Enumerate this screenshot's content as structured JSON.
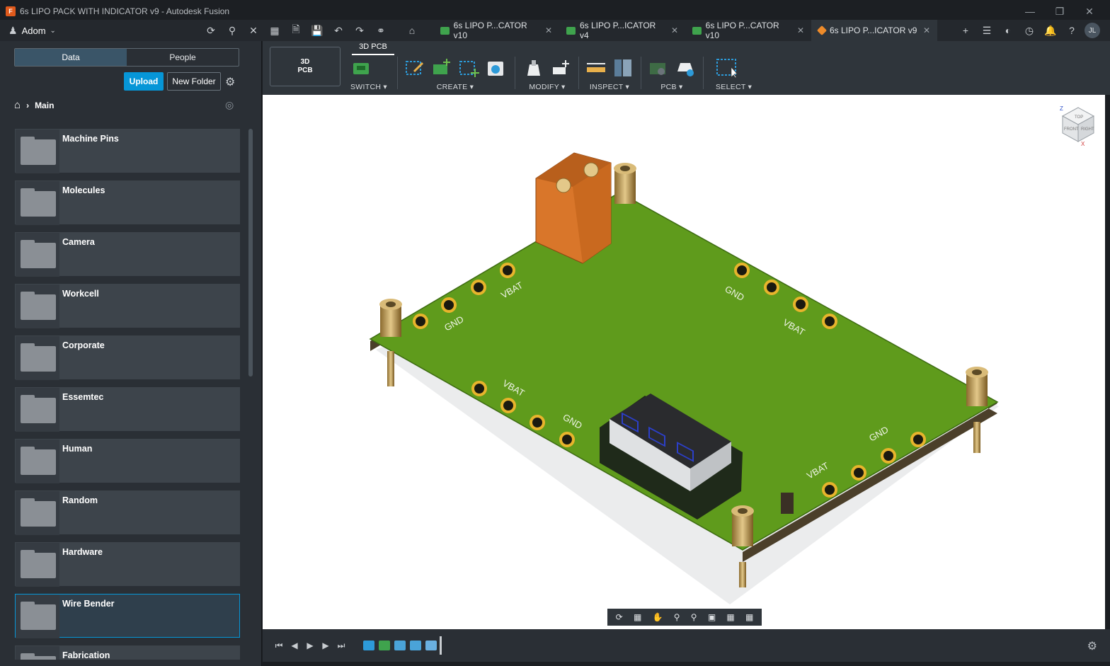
{
  "window": {
    "title": "6s LIPO PACK WITH INDICATOR v9 - Autodesk Fusion",
    "app_logo_letter": "F"
  },
  "topbar": {
    "team": "Adom",
    "avatar": "JL"
  },
  "tabs": [
    {
      "label": "6s LIPO P...CATOR v10",
      "icon": "pcb-icon"
    },
    {
      "label": "6s LIPO P...ICATOR v4",
      "icon": "schematic-icon"
    },
    {
      "label": "6s LIPO P...CATOR v10",
      "icon": "board-icon"
    },
    {
      "label": "6s LIPO P...ICATOR v9",
      "icon": "3d-model-icon"
    }
  ],
  "datapanel": {
    "segments": {
      "data": "Data",
      "people": "People"
    },
    "upload": "Upload",
    "new_folder": "New Folder",
    "breadcrumb": "Main",
    "folders": [
      "Machine Pins",
      "Molecules",
      "Camera",
      "Workcell",
      "Corporate",
      "Essemtec",
      "Human",
      "Random",
      "Hardware",
      "Wire Bender",
      "Fabrication"
    ],
    "selected_folder": "Wire Bender"
  },
  "toolbar": {
    "workspace": {
      "line1": "3D",
      "line2": "PCB"
    },
    "active_tab": "3D PCB",
    "groups": {
      "switch": "SWITCH",
      "create": "CREATE",
      "modify": "MODIFY",
      "inspect": "INSPECT",
      "pcb": "PCB",
      "select": "SELECT"
    }
  },
  "pcb": {
    "labels": [
      "VBAT",
      "GND",
      "GND",
      "VBAT",
      "VBAT",
      "GND",
      "GND",
      "VBAT"
    ]
  },
  "viewcube": {
    "front": "FRONT",
    "right": "RIGHT",
    "top": "TOP",
    "z": "Z",
    "x": "X"
  },
  "colors": {
    "accent": "#0696d7",
    "pcb_green": "#5f9b1c",
    "connector_orange": "#d9762a"
  }
}
